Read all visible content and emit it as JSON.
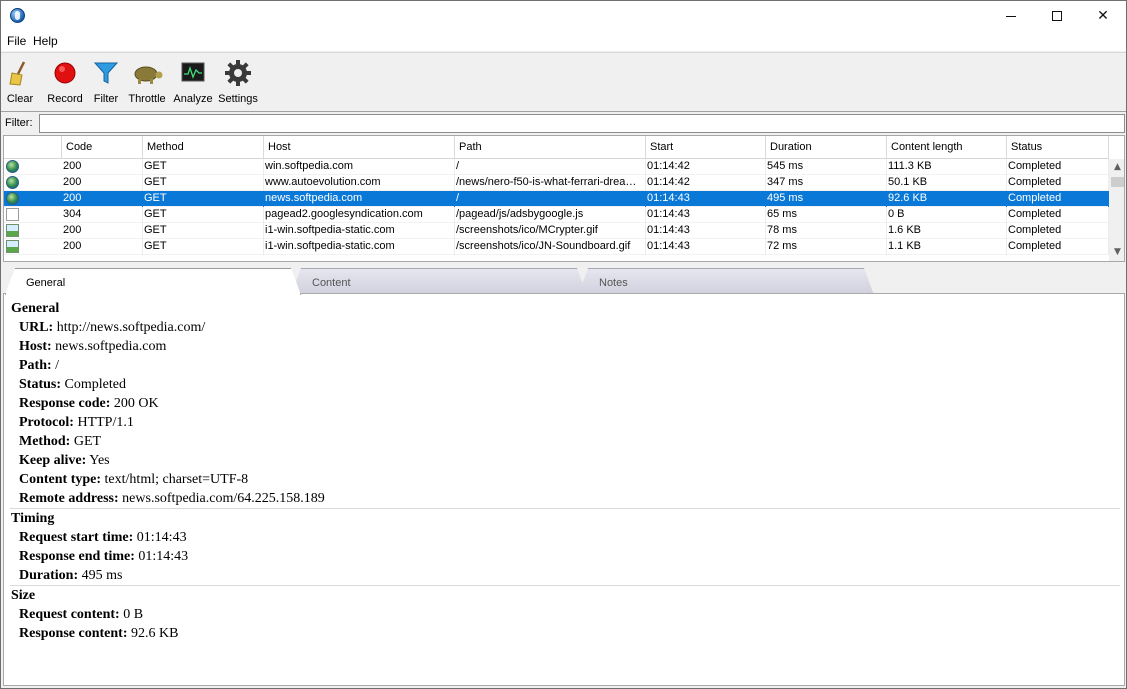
{
  "menu": {
    "file": "File",
    "help": "Help"
  },
  "toolbar": {
    "clear": "Clear",
    "record": "Record",
    "filter": "Filter",
    "throttle": "Throttle",
    "analyze": "Analyze",
    "settings": "Settings"
  },
  "filter": {
    "label": "Filter:",
    "value": ""
  },
  "columns": {
    "code": "Code",
    "method": "Method",
    "host": "Host",
    "path": "Path",
    "start": "Start",
    "duration": "Duration",
    "content_length": "Content length",
    "status": "Status"
  },
  "rows": [
    {
      "icon": "globe-icon",
      "code": "200",
      "method": "GET",
      "host": "win.softpedia.com",
      "path": "/",
      "start": "01:14:42",
      "duration": "545 ms",
      "length": "111.3 KB",
      "status": "Completed"
    },
    {
      "icon": "globe-icon",
      "code": "200",
      "method": "GET",
      "host": "www.autoevolution.com",
      "path": "/news/nero-f50-is-what-ferrari-drea…",
      "start": "01:14:42",
      "duration": "347 ms",
      "length": "50.1 KB",
      "status": "Completed"
    },
    {
      "icon": "globe-icon",
      "code": "200",
      "method": "GET",
      "host": "news.softpedia.com",
      "path": "/",
      "start": "01:14:43",
      "duration": "495 ms",
      "length": "92.6 KB",
      "status": "Completed"
    },
    {
      "icon": "document-icon",
      "code": "304",
      "method": "GET",
      "host": "pagead2.googlesyndication.com",
      "path": "/pagead/js/adsbygoogle.js",
      "start": "01:14:43",
      "duration": "65 ms",
      "length": "0 B",
      "status": "Completed"
    },
    {
      "icon": "image-icon",
      "code": "200",
      "method": "GET",
      "host": "i1-win.softpedia-static.com",
      "path": "/screenshots/ico/MCrypter.gif",
      "start": "01:14:43",
      "duration": "78 ms",
      "length": "1.6 KB",
      "status": "Completed"
    },
    {
      "icon": "image-icon",
      "code": "200",
      "method": "GET",
      "host": "i1-win.softpedia-static.com",
      "path": "/screenshots/ico/JN-Soundboard.gif",
      "start": "01:14:43",
      "duration": "72 ms",
      "length": "1.1 KB",
      "status": "Completed"
    }
  ],
  "tabs": {
    "general": "General",
    "content": "Content",
    "notes": "Notes"
  },
  "details": {
    "general_title": "General",
    "url_k": "URL:",
    "url_v": "http://news.softpedia.com/",
    "host_k": "Host:",
    "host_v": "news.softpedia.com",
    "path_k": "Path:",
    "path_v": "/",
    "status_k": "Status:",
    "status_v": "Completed",
    "code_k": "Response code:",
    "code_v": "200 OK",
    "proto_k": "Protocol:",
    "proto_v": "HTTP/1.1",
    "method_k": "Method:",
    "method_v": "GET",
    "keep_k": "Keep alive:",
    "keep_v": "Yes",
    "ctype_k": "Content type:",
    "ctype_v": "text/html; charset=UTF-8",
    "remote_k": "Remote address:",
    "remote_v": "news.softpedia.com/64.225.158.189",
    "timing_title": "Timing",
    "rstart_k": "Request start time:",
    "rstart_v": "01:14:43",
    "rend_k": "Response end time:",
    "rend_v": "01:14:43",
    "dur_k": "Duration:",
    "dur_v": "495 ms",
    "size_title": "Size",
    "reqc_k": "Request content:",
    "reqc_v": "0 B",
    "resc_k": "Response content:",
    "resc_v": "92.6 KB"
  },
  "colors": {
    "selection": "#0a78d7",
    "record": "#e01010",
    "filter": "#2f9be0"
  }
}
